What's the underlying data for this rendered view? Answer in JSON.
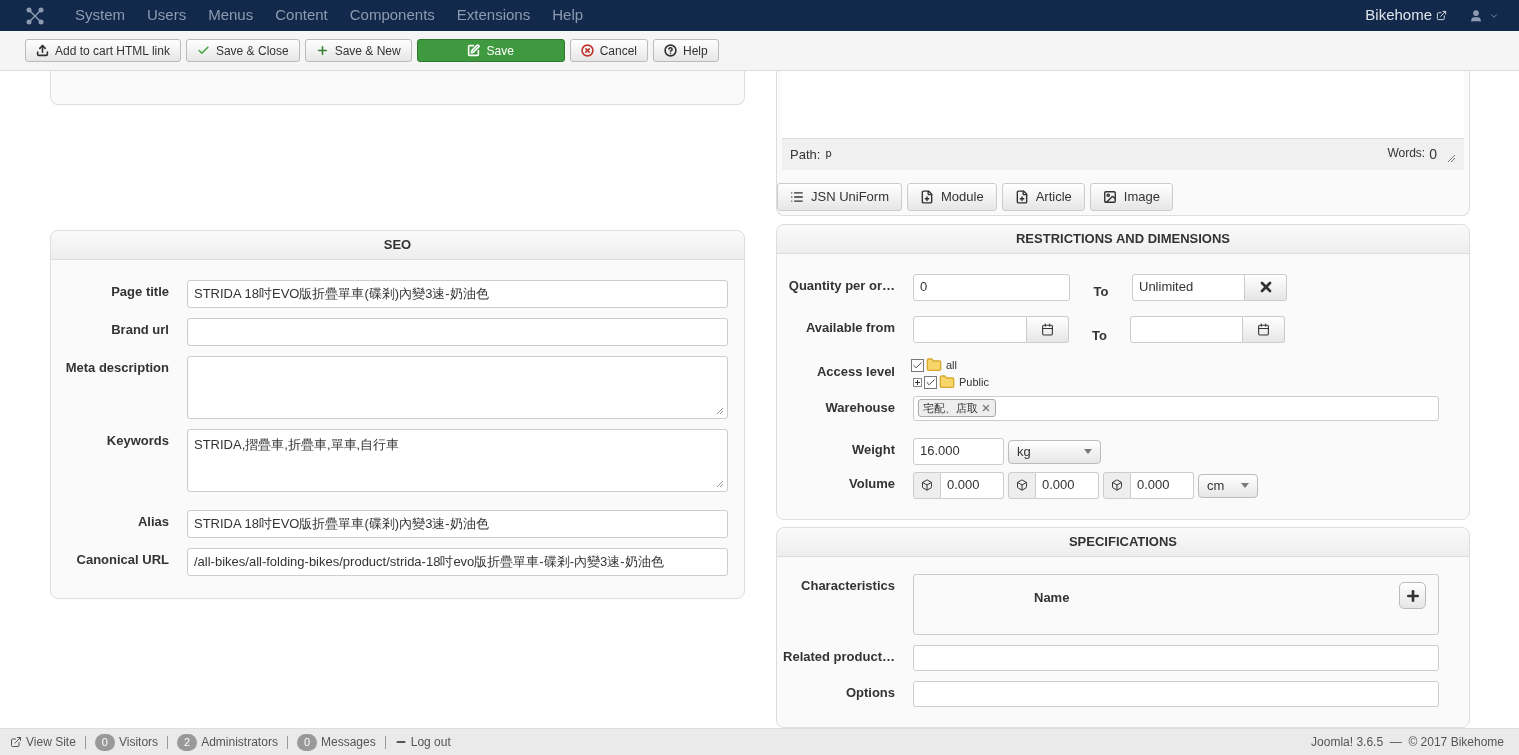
{
  "nav": {
    "menu": [
      "System",
      "Users",
      "Menus",
      "Content",
      "Components",
      "Extensions",
      "Help"
    ],
    "site": "Bikehome"
  },
  "toolbar": [
    {
      "label": "Add to cart HTML link",
      "kind": "default"
    },
    {
      "label": "Save & Close",
      "kind": "default"
    },
    {
      "label": "Save & New",
      "kind": "default"
    },
    {
      "label": "Save",
      "kind": "primary"
    },
    {
      "label": "Cancel",
      "kind": "default"
    },
    {
      "label": "Help",
      "kind": "default"
    }
  ],
  "editor": {
    "path_label": "Path:",
    "path": "p",
    "words_label": "Words:",
    "words": "0",
    "buttons": [
      "JSN UniForm",
      "Module",
      "Article",
      "Image"
    ]
  },
  "seo": {
    "title": "SEO",
    "fields": [
      {
        "label": "Page title",
        "kind": "input",
        "value": "STRIDA 18吋EVO版折疊單車(碟剎)內變3速-奶油色"
      },
      {
        "label": "Brand url",
        "kind": "input"
      },
      {
        "label": "Meta description",
        "kind": "textarea"
      },
      {
        "label": "Keywords",
        "kind": "textarea",
        "value": "STRIDA,摺疊車,折疊車,單車,自行車"
      },
      {
        "label": "Alias",
        "kind": "input",
        "value": "STRIDA 18吋EVO版折疊單車(碟剎)內變3速-奶油色"
      },
      {
        "label": "Canonical URL",
        "kind": "input",
        "value": "/all-bikes/all-folding-bikes/product/strida-18吋evo版折疊單車-碟剎-內變3速-奶油色"
      }
    ]
  },
  "restrictions": {
    "title": "RESTRICTIONS AND DIMENSIONS",
    "quantity": {
      "label": "Quantity per or…",
      "value": "0",
      "to_label": "To",
      "to_value": "Unlimited"
    },
    "available": {
      "label": "Available from",
      "to_label": "To"
    },
    "access": {
      "label": "Access level",
      "tree": [
        {
          "label": "all",
          "checked": true,
          "children": [
            {
              "label": "Public",
              "checked": true,
              "expanded": false
            }
          ]
        }
      ]
    },
    "warehouse": {
      "label": "Warehouse",
      "tags": [
        "宅配、店取"
      ]
    },
    "weight": {
      "label": "Weight",
      "value": "16.000",
      "unit": "kg"
    },
    "volume": {
      "label": "Volume",
      "values": [
        "0.000",
        "0.000",
        "0.000"
      ],
      "unit": "cm"
    }
  },
  "specs": {
    "title": "SPECIFICATIONS",
    "characteristics": {
      "label": "Characteristics",
      "column": "Name"
    },
    "fields": [
      {
        "label": "Related product…"
      },
      {
        "label": "Options"
      }
    ]
  },
  "footer": {
    "items": [
      {
        "label": "View Site"
      },
      {
        "label": "Visitors",
        "count": "0"
      },
      {
        "label": "Administrators",
        "count": "2"
      },
      {
        "label": "Messages",
        "count": "0"
      },
      {
        "label": "Log out"
      }
    ],
    "version": "Joomla! 3.6.5  —  © 2017 Bikehome"
  }
}
